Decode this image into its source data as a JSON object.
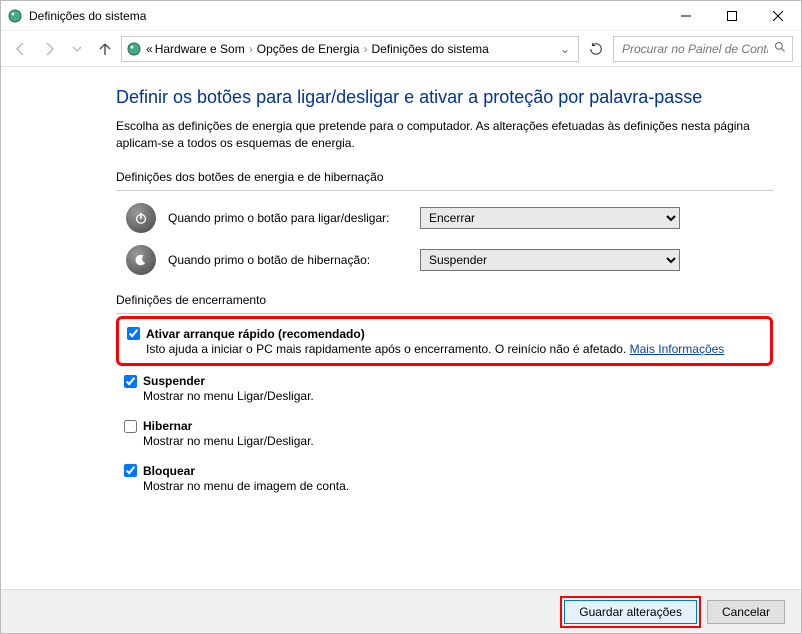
{
  "window": {
    "title": "Definições do sistema"
  },
  "breadcrumb": {
    "prefix": "«",
    "items": [
      "Hardware e Som",
      "Opções de Energia",
      "Definições do sistema"
    ]
  },
  "search": {
    "placeholder": "Procurar no Painel de Controlo"
  },
  "page": {
    "title": "Definir os botões para ligar/desligar e ativar a proteção por palavra-passe",
    "intro": "Escolha as definições de energia que pretende para o computador. As alterações efetuadas às definições nesta página aplicam-se a todos os esquemas de energia."
  },
  "section1": {
    "head": "Definições dos botões de energia e de hibernação",
    "power_label": "Quando primo o botão para ligar/desligar:",
    "power_value": "Encerrar",
    "sleep_label": "Quando primo o botão de hibernação:",
    "sleep_value": "Suspender"
  },
  "section2": {
    "head": "Definições de encerramento",
    "items": [
      {
        "checked": true,
        "label": "Ativar arranque rápido (recomendado)",
        "desc": "Isto ajuda a iniciar o PC mais rapidamente após o encerramento. O reinício não é afetado. ",
        "link": "Mais Informações"
      },
      {
        "checked": true,
        "label": "Suspender",
        "desc": "Mostrar no menu Ligar/Desligar."
      },
      {
        "checked": false,
        "label": "Hibernar",
        "desc": "Mostrar no menu Ligar/Desligar."
      },
      {
        "checked": true,
        "label": "Bloquear",
        "desc": "Mostrar no menu de imagem de conta."
      }
    ]
  },
  "footer": {
    "save": "Guardar alterações",
    "cancel": "Cancelar"
  }
}
